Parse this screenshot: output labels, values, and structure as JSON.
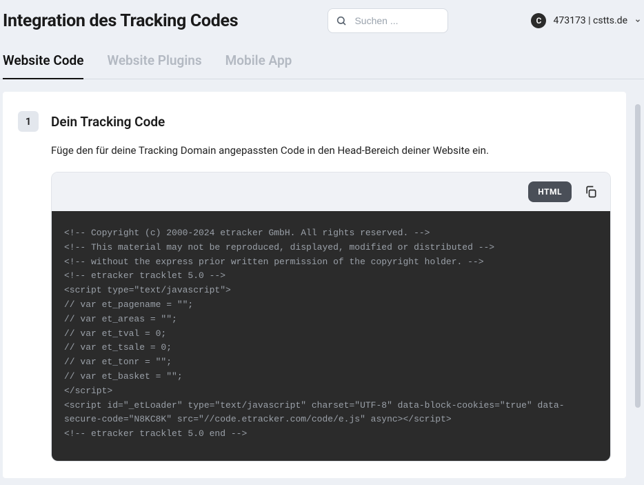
{
  "header": {
    "title": "Integration des Tracking Codes",
    "search_placeholder": "Suchen ...",
    "account": {
      "avatar_letter": "C",
      "label": "473173 | cstts.de"
    }
  },
  "tabs": [
    {
      "label": "Website Code",
      "active": true
    },
    {
      "label": "Website Plugins",
      "active": false
    },
    {
      "label": "Mobile App",
      "active": false
    }
  ],
  "step": {
    "number": "1",
    "title": "Dein Tracking Code",
    "description": "Füge den für deine Tracking Domain angepassten Code in den Head-Bereich deiner Website ein."
  },
  "code": {
    "badge": "HTML",
    "content": "<!-- Copyright (c) 2000-2024 etracker GmbH. All rights reserved. -->\n<!-- This material may not be reproduced, displayed, modified or distributed -->\n<!-- without the express prior written permission of the copyright holder. -->\n<!-- etracker tracklet 5.0 -->\n<script type=\"text/javascript\">\n// var et_pagename = \"\";\n// var et_areas = \"\";\n// var et_tval = 0;\n// var et_tsale = 0;\n// var et_tonr = \"\";\n// var et_basket = \"\";\n</script>\n<script id=\"_etLoader\" type=\"text/javascript\" charset=\"UTF-8\" data-block-cookies=\"true\" data-secure-code=\"N8KC8K\" src=\"//code.etracker.com/code/e.js\" async></script>\n<!-- etracker tracklet 5.0 end -->"
  }
}
